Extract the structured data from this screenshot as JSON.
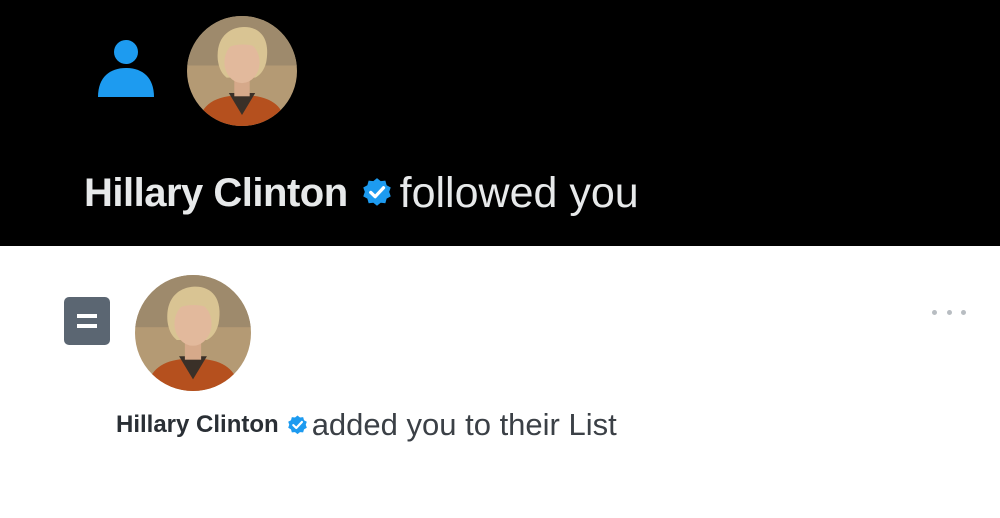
{
  "colors": {
    "dark_background": "#000000",
    "light_background": "#ffffff",
    "accent_blue": "#1d9bf0",
    "list_icon_gray": "#5b6672"
  },
  "follow_notification": {
    "icon": "person-icon",
    "user_name": "Hillary Clinton",
    "verified_icon": "verified-badge-icon",
    "action_text": "followed you"
  },
  "list_notification": {
    "icon": "list-icon",
    "user_name": "Hillary Clinton",
    "verified_icon": "verified-badge-icon",
    "action_text": "added you to their List",
    "more_icon": "more-options-icon"
  }
}
